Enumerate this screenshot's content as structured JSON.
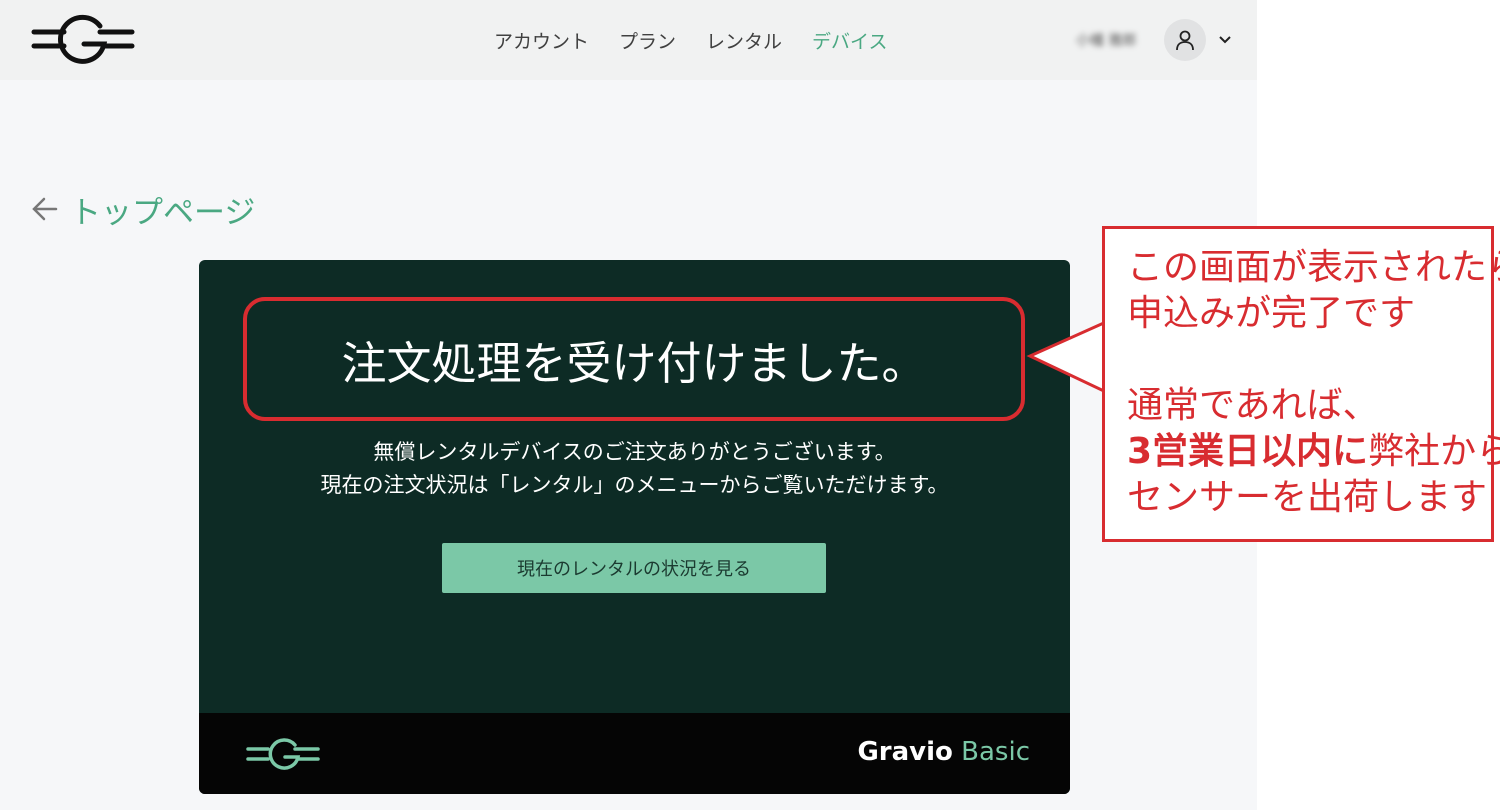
{
  "nav": {
    "items": [
      {
        "label": "アカウント",
        "active": false
      },
      {
        "label": "プラン",
        "active": false
      },
      {
        "label": "レンタル",
        "active": false
      },
      {
        "label": "デバイス",
        "active": true
      }
    ]
  },
  "user": {
    "name": "小幡 雅郎"
  },
  "back": {
    "label": "トップページ"
  },
  "card": {
    "title": "注文処理を受け付けました。",
    "desc_line1": "無償レンタルデバイスのご注文ありがとうございます。",
    "desc_line2": "現在の注文状況は「レンタル」のメニューからご覧いただけます。",
    "button": "現在のレンタルの状況を見る"
  },
  "footer": {
    "brand_name": "Gravio",
    "brand_edition": "Basic"
  },
  "callout": {
    "line1": "この画面が表示されたら",
    "line2": "申込みが完了です",
    "line3": "通常であれば、",
    "line4_bold": "3営業日以内に",
    "line4_rest": "弊社から",
    "line5": "センサーを出荷します"
  },
  "colors": {
    "accent": "#4aa882",
    "card_bg": "#0d2b25",
    "button_bg": "#7bc8a7",
    "callout_red": "#d82c30",
    "footer_bg": "#050505"
  },
  "icons": [
    "gravio-logo-icon",
    "user-icon",
    "chevron-down-icon",
    "arrow-left-icon"
  ]
}
